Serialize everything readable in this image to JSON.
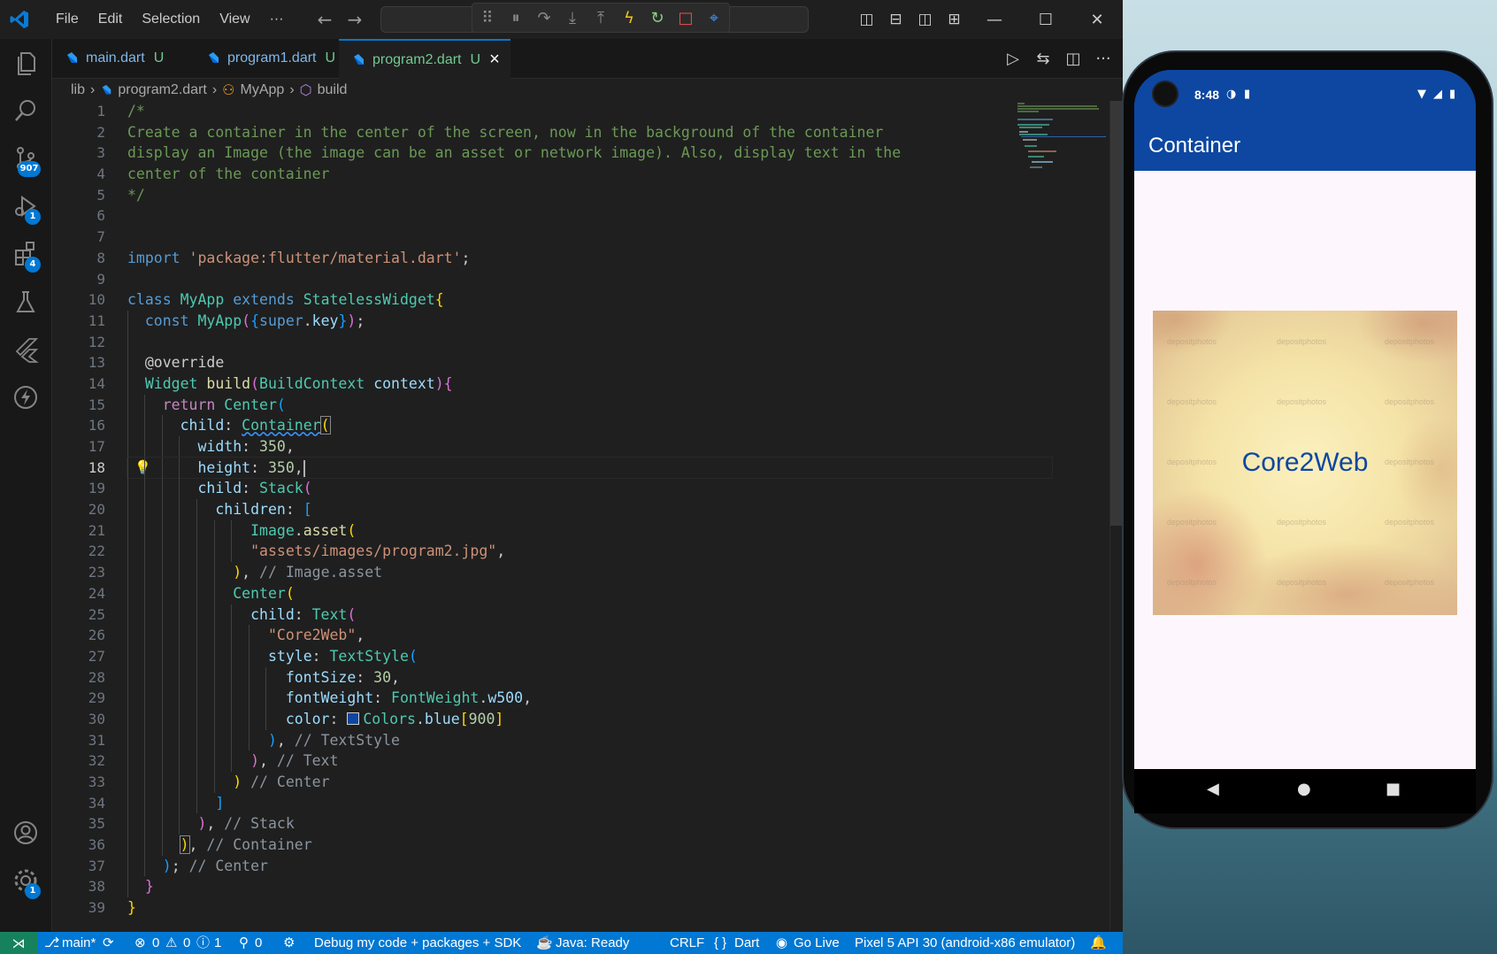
{
  "titlebar": {
    "menu": [
      "File",
      "Edit",
      "Selection",
      "View",
      "···"
    ],
    "back": "←",
    "forward": "→"
  },
  "activity": {
    "scm_badge": "907",
    "debug_badge": "1",
    "ext_badge": "4",
    "settings_badge": "1"
  },
  "tabs": [
    {
      "label": "main.dart",
      "mod": "U",
      "active": false
    },
    {
      "label": "program1.dart",
      "mod": "U",
      "active": false
    },
    {
      "label": "program2.dart",
      "mod": "U",
      "active": true
    }
  ],
  "tab_close": "×",
  "breadcrumb": {
    "folder": "lib",
    "file": "program2.dart",
    "class": "MyApp",
    "method": "build"
  },
  "editor": {
    "current_line": 18,
    "line_count": 39
  },
  "statusbar": {
    "branch": "main*",
    "errors": "0",
    "warnings": "0",
    "info": "1",
    "ports": "0",
    "debug": "Debug my code + packages + SDK",
    "java": "Java: Ready",
    "eol": "CRLF",
    "language": "Dart",
    "golive": "Go Live",
    "device": "Pixel 5 API 30 (android-x86 emulator)"
  },
  "phone": {
    "time": "8:48",
    "appbar_title": "Container",
    "center_text": "Core2Web",
    "accent_color": "#0d47a1",
    "watermark": "depositphotos"
  },
  "colors": {
    "vscode_bg": "#1f1f1f",
    "statusbar_bg": "#0078d4",
    "app_blue": "#0d47a1"
  }
}
